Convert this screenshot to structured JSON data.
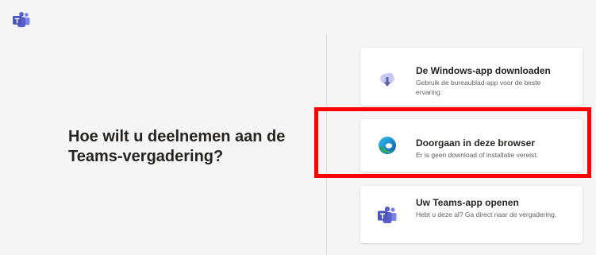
{
  "app": {
    "logo_icon": "teams-logo-icon",
    "brand_color": "#5b5fc7"
  },
  "prompt": {
    "heading": "Hoe wilt u deelnemen aan de Teams-vergadering?"
  },
  "options": [
    {
      "title": "De Windows-app downloaden",
      "subtitle": "Gebruik de bureaublad-app voor de beste ervaring.",
      "icon": "download-cloud-icon"
    },
    {
      "title": "Doorgaan in deze browser",
      "subtitle": "Er is geen download of installatie vereist.",
      "icon": "edge-browser-icon"
    },
    {
      "title": "Uw Teams-app openen",
      "subtitle": "Hebt u deze al? Ga direct naar de vergadering.",
      "icon": "teams-logo-icon"
    }
  ],
  "annotation": {
    "highlight_color": "#ff0000",
    "highlighted_option": "Doorgaan in deze browser"
  }
}
